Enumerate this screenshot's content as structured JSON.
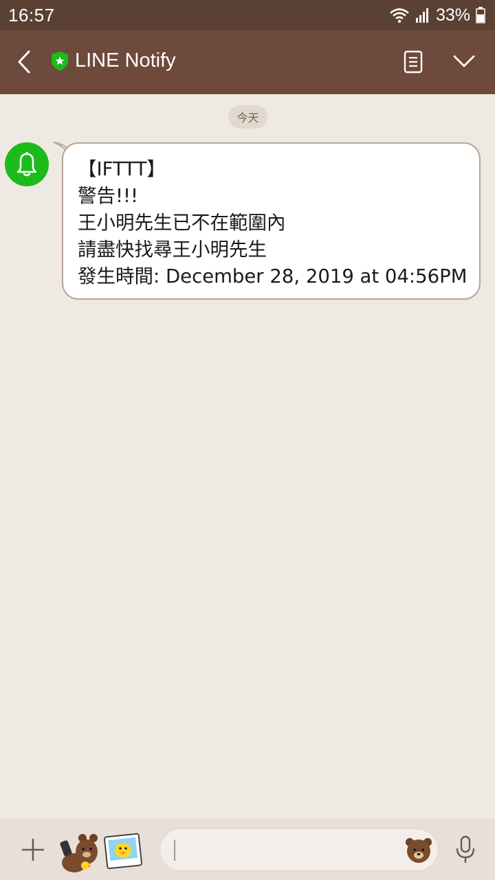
{
  "status_bar": {
    "time": "16:57",
    "battery_percent": "33%",
    "wifi_icon": "wifi-icon",
    "signal_icon": "signal-icon",
    "battery_icon": "battery-icon"
  },
  "header": {
    "title": "LINE Notify",
    "back_icon": "back-arrow-icon",
    "verified_icon": "green-shield-star-icon",
    "notes_icon": "note-icon",
    "menu_icon": "chevron-down-icon",
    "bg_color": "#6d4a3b"
  },
  "chat": {
    "date_label": "今天",
    "messages": [
      {
        "sender_avatar_icon": "bell-icon",
        "avatar_color": "#1cbb1c",
        "lines": [
          "【IFTTT】",
          "警告!!!",
          "王小明先生已不在範圍內",
          "請盡快找尋王小明先生",
          "發生時間: December 28, 2019 at 04:56PM"
        ]
      }
    ]
  },
  "input_bar": {
    "plus_icon": "plus-icon",
    "sticker_icon_1": "brown-bear-sticker-icon",
    "sticker_icon_2": "sally-chick-photo-icon",
    "text_value": "",
    "emoji_icon": "bear-emoji-icon",
    "mic_icon": "microphone-icon"
  }
}
